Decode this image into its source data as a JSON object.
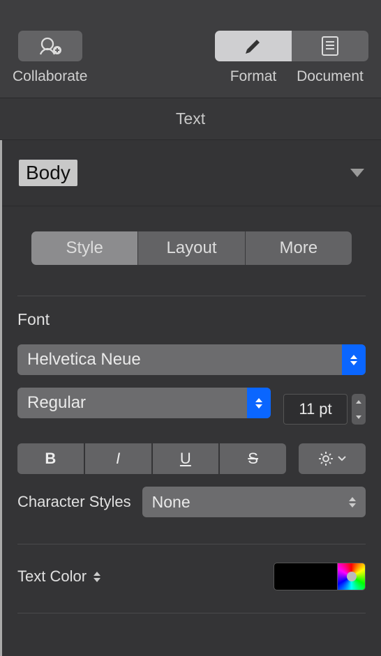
{
  "toolbar": {
    "collaborate_label": "Collaborate",
    "format_label": "Format",
    "document_label": "Document"
  },
  "header": {
    "title": "Text"
  },
  "paragraph_style": {
    "selected": "Body"
  },
  "tabs": {
    "style": "Style",
    "layout": "Layout",
    "more": "More",
    "active": "style"
  },
  "font": {
    "heading": "Font",
    "family": "Helvetica Neue",
    "weight": "Regular",
    "size": "11 pt",
    "buttons": {
      "bold": "B",
      "italic": "I",
      "underline": "U",
      "strike": "S"
    },
    "character_styles_label": "Character Styles",
    "character_style_value": "None"
  },
  "text_color": {
    "label": "Text Color",
    "value": "#000000"
  }
}
